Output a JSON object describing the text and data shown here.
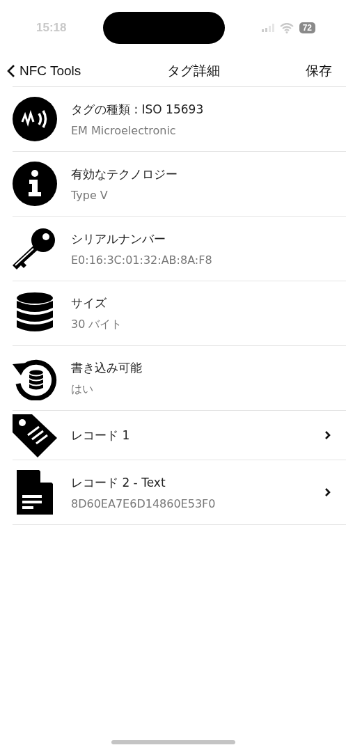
{
  "status_bar": {
    "time": "15:18",
    "battery": "72"
  },
  "nav": {
    "back": "NFC Tools",
    "title": "タグ詳細",
    "action": "保存"
  },
  "rows": [
    {
      "kind": "nfc",
      "title": "タグの種類 : ISO 15693",
      "subtitle": "EM Microelectronic",
      "navigable": false
    },
    {
      "kind": "info",
      "title": "有効なテクノロジー",
      "subtitle": "Type V",
      "navigable": false
    },
    {
      "kind": "key",
      "title": "シリアルナンバー",
      "subtitle": "E0:16:3C:01:32:AB:8A:F8",
      "navigable": false
    },
    {
      "kind": "database",
      "title": "サイズ",
      "subtitle": "30 バイト",
      "navigable": false
    },
    {
      "kind": "writable",
      "title": "書き込み可能",
      "subtitle": "はい",
      "navigable": false
    },
    {
      "kind": "tag",
      "title": "レコード 1",
      "navigable": true
    },
    {
      "kind": "document",
      "title": "レコード 2 - Text",
      "subtitle": "8D60EA7E6D14860E53F0",
      "navigable": true
    }
  ]
}
